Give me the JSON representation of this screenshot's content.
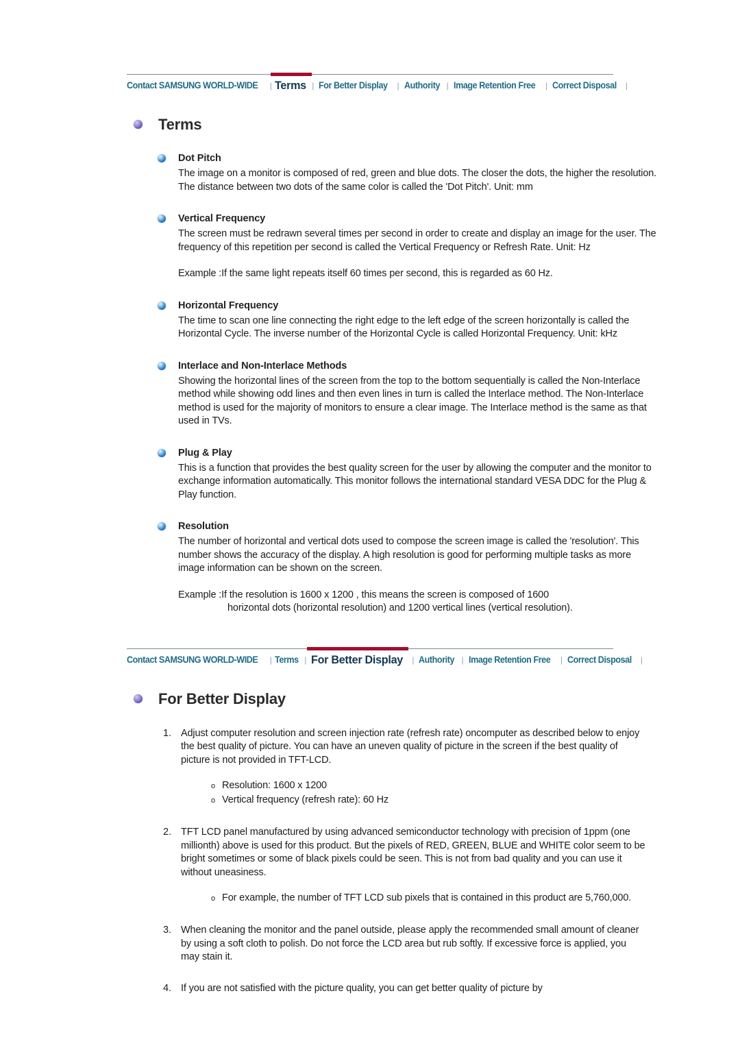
{
  "colors": {
    "nav_link": "#1f6b86",
    "nav_active": "#15364f",
    "accent_red": "#a50d2d",
    "rule": "#7a8a92",
    "bullet_purple": "#6f5fbe",
    "bullet_blue": "#2f7fc6"
  },
  "nav_primary": {
    "items": [
      {
        "label": "Contact SAMSUNG WORLD-WIDE",
        "active": false
      },
      {
        "label": "Terms",
        "active": true
      },
      {
        "label": "For Better Display",
        "active": false
      },
      {
        "label": "Authority",
        "active": false
      },
      {
        "label": "Image Retention Free",
        "active": false
      },
      {
        "label": "Correct Disposal",
        "active": false
      }
    ],
    "separator": "|"
  },
  "nav_secondary": {
    "items": [
      {
        "label": "Contact SAMSUNG WORLD-WIDE",
        "active": false
      },
      {
        "label": "Terms",
        "active": false
      },
      {
        "label": "For Better Display",
        "active": true
      },
      {
        "label": "Authority",
        "active": false
      },
      {
        "label": "Image Retention Free",
        "active": false
      },
      {
        "label": "Correct Disposal",
        "active": false
      }
    ],
    "separator": "|"
  },
  "terms": {
    "title": "Terms",
    "sections": [
      {
        "heading": "Dot Pitch",
        "body": "The image on a monitor is composed of red, green and blue dots. The closer the dots, the higher the resolution. The distance between two dots of the same color is called the 'Dot Pitch'. Unit: mm",
        "example": "",
        "example_cont": ""
      },
      {
        "heading": "Vertical Frequency",
        "body": "The screen must be redrawn several times per second in order to create and display an image for the user. The frequency of this repetition per second is called the Vertical Frequency or Refresh Rate. Unit: Hz",
        "example": "Example :If the same light repeats itself 60 times per second, this is regarded as 60 Hz.",
        "example_cont": ""
      },
      {
        "heading": "Horizontal Frequency",
        "body": "The time to scan one line connecting the right edge to the left edge of the screen horizontally is called the Horizontal Cycle. The inverse number of the Horizontal Cycle is called Horizontal Frequency. Unit: kHz",
        "example": "",
        "example_cont": ""
      },
      {
        "heading": "Interlace and Non-Interlace Methods",
        "body": "Showing the horizontal lines of the screen from the top to the bottom sequentially is called the Non-Interlace method while showing odd lines and then even lines in turn is called the Interlace method. The Non-Interlace method is used for the majority of monitors to ensure a clear image. The Interlace method is the same as that used in TVs.",
        "example": "",
        "example_cont": ""
      },
      {
        "heading": "Plug & Play",
        "body": "This is a function that provides the best quality screen for the user by allowing the computer and the monitor to exchange information automatically. This monitor follows the international standard VESA DDC for the Plug & Play function.",
        "example": "",
        "example_cont": ""
      },
      {
        "heading": "Resolution",
        "body": "The number of horizontal and vertical dots used to compose the screen image is called the 'resolution'. This number shows the accuracy of the display. A high resolution is good for performing multiple tasks as more image information can be shown on the screen.",
        "example": "Example :If the resolution is 1600 x 1200 , this means the screen is composed of 1600",
        "example_cont": "horizontal dots (horizontal resolution) and 1200 vertical lines (vertical resolution)."
      }
    ]
  },
  "better_display": {
    "title": "For Better Display",
    "items": [
      {
        "num": "1.",
        "text": "Adjust computer resolution and screen injection rate (refresh rate) oncomputer as described below to enjoy the best quality of picture. You can have an uneven quality of picture in the screen if the best quality of picture is not provided in TFT-LCD.",
        "sub": [
          "Resolution: 1600 x 1200",
          "Vertical frequency (refresh rate): 60 Hz"
        ]
      },
      {
        "num": "2.",
        "text": "TFT LCD panel manufactured by using advanced semiconductor technology with precision of 1ppm (one millionth) above is used for this product. But the pixels of RED, GREEN, BLUE and WHITE color seem to be bright sometimes or some of black pixels could be seen. This is not from bad quality and you can use it without uneasiness.",
        "sub": [
          "For example, the number of TFT LCD sub pixels that is contained in this product are 5,760,000."
        ]
      },
      {
        "num": "3.",
        "text": "When cleaning the monitor and the panel outside, please apply the recommended small amount of cleaner by using a soft cloth to polish. Do not force the LCD area but rub softly. If excessive force is applied, you may stain it.",
        "sub": []
      },
      {
        "num": "4.",
        "text": "If you are not satisfied with the picture quality, you can get better quality of picture by",
        "sub": []
      }
    ],
    "sub_marker": "o"
  }
}
